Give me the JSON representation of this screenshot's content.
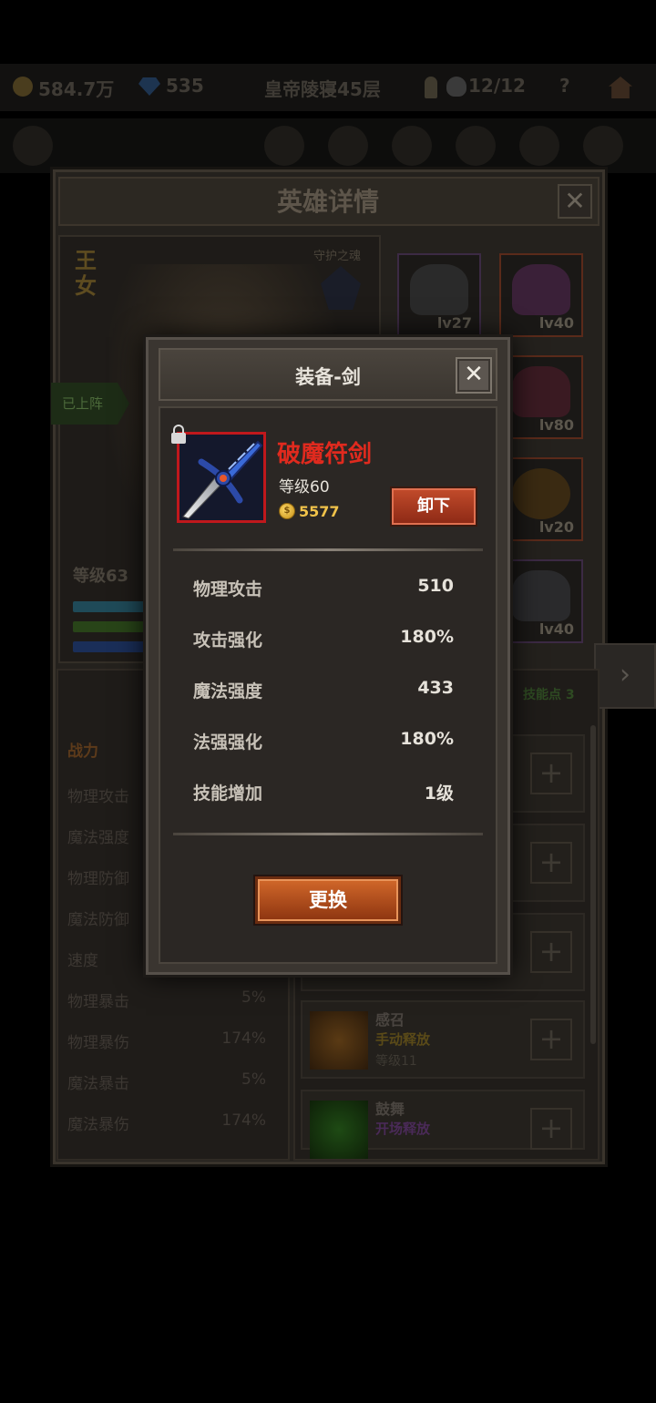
{
  "topbar": {
    "gold": "584.7万",
    "gems": "535",
    "tomb": "皇帝陵寝45层",
    "keys": "12/12",
    "help": "?"
  },
  "hero_panel": {
    "title": "英雄详情",
    "close": "✕",
    "hero_name": "王女",
    "guardian_label": "守护之魂",
    "deployed": "已上阵",
    "level": "等级63",
    "next_arrow": "›"
  },
  "equip_slots": [
    {
      "level": "lv27"
    },
    {
      "level": "lv40"
    },
    {
      "level": "lv80"
    },
    {
      "level": "lv20"
    },
    {
      "level": "lv40"
    }
  ],
  "stats": {
    "header": "战力",
    "rows": [
      {
        "label": "物理攻击",
        "value": ""
      },
      {
        "label": "魔法强度",
        "value": ""
      },
      {
        "label": "物理防御",
        "value": ""
      },
      {
        "label": "魔法防御",
        "value": ""
      },
      {
        "label": "速度",
        "value": ""
      },
      {
        "label": "物理暴击",
        "value": "5%"
      },
      {
        "label": "物理暴伤",
        "value": "174%"
      },
      {
        "label": "魔法暴击",
        "value": "5%"
      },
      {
        "label": "魔法暴伤",
        "value": "174%"
      }
    ]
  },
  "skills": {
    "points": "技能点 3",
    "plus": "+",
    "cards": [
      {
        "name": "感召",
        "mode": "手动释放",
        "level": "等级11"
      },
      {
        "name": "鼓舞",
        "mode": "开场释放",
        "level": ""
      }
    ]
  },
  "modal": {
    "title": "装备-剑",
    "close": "✕",
    "item_name": "破魔符剑",
    "item_level": "等级60",
    "coin_symbol": "$",
    "price": "5577",
    "unequip": "卸下",
    "stats": [
      {
        "label": "物理攻击",
        "value": "510"
      },
      {
        "label": "攻击强化",
        "value": "180%"
      },
      {
        "label": "魔法强度",
        "value": "433"
      },
      {
        "label": "法强强化",
        "value": "180%"
      },
      {
        "label": "技能增加",
        "value": "1级"
      }
    ],
    "replace": "更换"
  },
  "colors": {
    "item_name": "#e02a1e",
    "item_frame": "#c0181c",
    "price": "#f0c24a",
    "button_orange": "#c04a2a"
  }
}
